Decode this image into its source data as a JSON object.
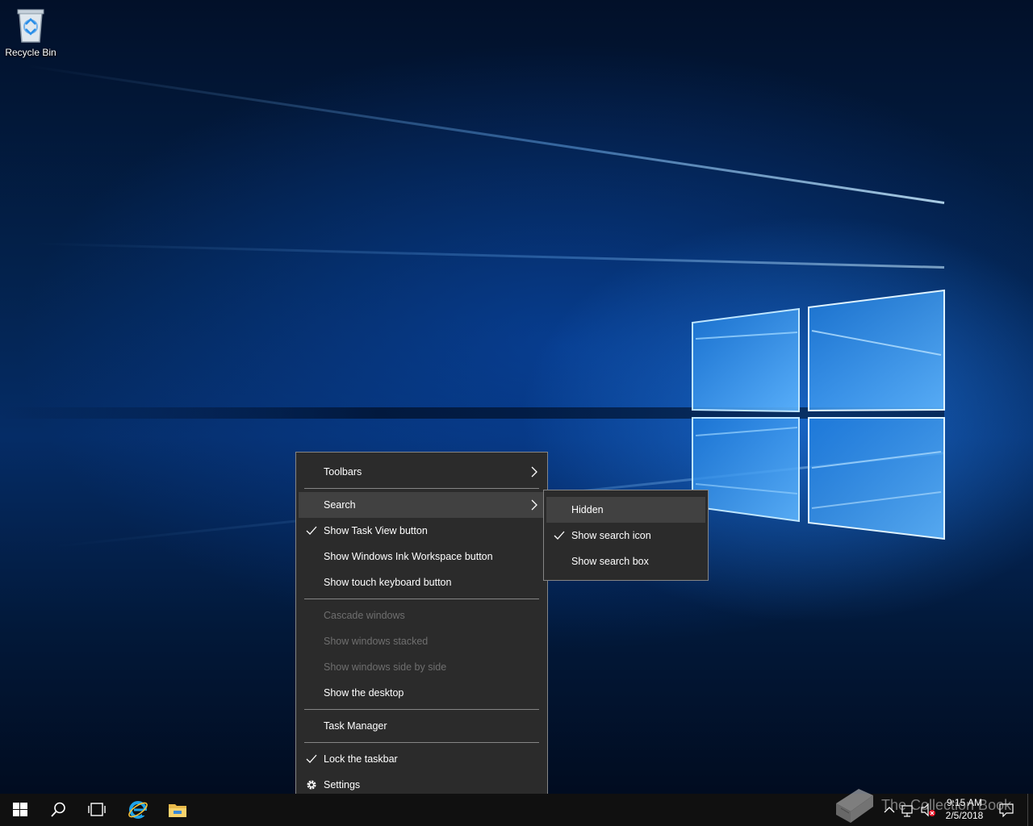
{
  "desktop": {
    "icons": [
      {
        "label": "Recycle Bin",
        "icon": "recycle-bin-icon"
      }
    ]
  },
  "context_menu": {
    "items": [
      {
        "label": "Toolbars",
        "has_submenu": true
      },
      {
        "label": "Search",
        "has_submenu": true,
        "highlighted": true
      },
      {
        "label": "Show Task View button",
        "checked": true
      },
      {
        "label": "Show Windows Ink Workspace button"
      },
      {
        "label": "Show touch keyboard button"
      },
      {
        "label": "Cascade windows",
        "disabled": true
      },
      {
        "label": "Show windows stacked",
        "disabled": true
      },
      {
        "label": "Show windows side by side",
        "disabled": true
      },
      {
        "label": "Show the desktop"
      },
      {
        "label": "Task Manager"
      },
      {
        "label": "Lock the taskbar",
        "checked": true
      },
      {
        "label": "Settings",
        "icon": "gear-icon"
      }
    ]
  },
  "search_submenu": {
    "items": [
      {
        "label": "Hidden",
        "highlighted": true
      },
      {
        "label": "Show search icon",
        "checked": true
      },
      {
        "label": "Show search box"
      }
    ]
  },
  "taskbar": {
    "pinned": [
      {
        "icon": "windows-start-icon"
      },
      {
        "icon": "search-icon"
      },
      {
        "icon": "task-view-icon"
      },
      {
        "icon": "internet-explorer-icon"
      },
      {
        "icon": "file-explorer-icon"
      }
    ],
    "tray_icons": [
      "chevron-up-icon",
      "network-icon",
      "volume-muted-icon",
      "action-center-icon"
    ],
    "clock": {
      "time": "9:15 AM",
      "date": "2/5/2018"
    }
  },
  "watermark": {
    "text": "The Collection Book",
    "icon": "book-icon"
  },
  "colors": {
    "menu_bg": "#2b2b2b",
    "menu_highlight": "#414141",
    "menu_border": "#858585",
    "disabled_text": "#6f6f6f",
    "taskbar_bg": "#101010"
  }
}
